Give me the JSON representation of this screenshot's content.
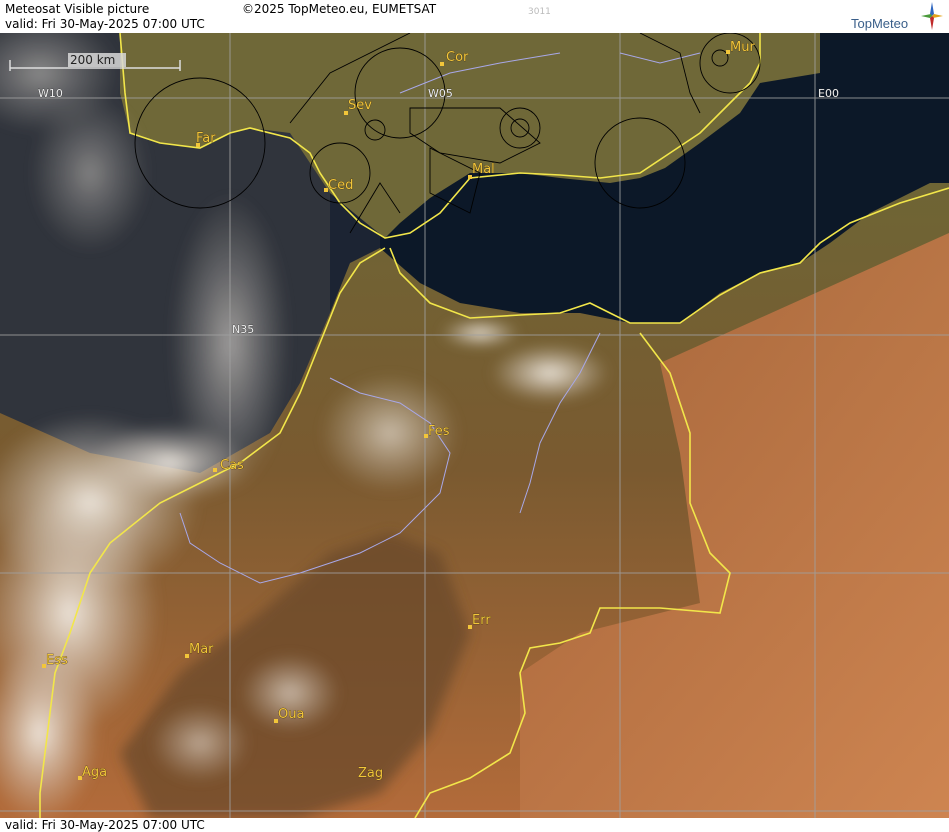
{
  "header": {
    "title": "Meteosat Visible picture",
    "valid": "valid:  Fri  30-May-2025  07:00 UTC",
    "copyright": "©2025 TopMeteo.eu, EUMETSAT",
    "code": "3011"
  },
  "logo": {
    "text": "TopMeteo"
  },
  "footer": {
    "valid": "valid:  Fri  30-May-2025  07:00 UTC"
  },
  "map": {
    "scale_label": "200 km",
    "grid_labels": {
      "w10": "W10",
      "w05": "W05",
      "e00": "E00",
      "n35": "N35"
    },
    "cities": {
      "cor": "Cor",
      "mur": "Mur",
      "sev": "Sev",
      "far": "Far",
      "ced": "Ced",
      "mal": "Mal",
      "fes": "Fes",
      "cas": "Cas",
      "err": "Err",
      "mar": "Mar",
      "ess": "Ess",
      "oua": "Oua",
      "aga": "Aga",
      "zag": "Zag"
    },
    "colors": {
      "sea": "#0d1a2c",
      "land_north": "#6b6233",
      "land_south": "#b8703a",
      "cloud": "#ebe3d8",
      "coastline": "#f2e64a",
      "city_label": "#f2c63a",
      "grid": "#a0a0a0",
      "airspace": "#000000",
      "river": "#a8a8e8"
    }
  }
}
